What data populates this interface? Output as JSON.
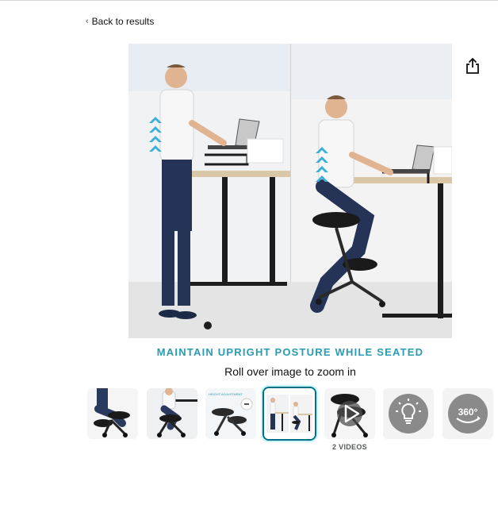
{
  "nav": {
    "back_chevron": "‹",
    "back_label": "Back to results"
  },
  "share": {
    "icon": "share-icon"
  },
  "main_image": {
    "icon": "standing-and-kneeling-chair-photo"
  },
  "caption": "MAINTAIN UPRIGHT POSTURE WHILE SEATED",
  "zoom_hint": "Roll over image to zoom in",
  "thumbnails": [
    {
      "icon": "kneeling-chair-side-view",
      "selected": false
    },
    {
      "icon": "man-on-kneeling-chair",
      "selected": false
    },
    {
      "icon": "height-adjustment-chair",
      "selected": false
    },
    {
      "icon": "standing-vs-seated-desk",
      "selected": true
    },
    {
      "icon": "video-play-icon",
      "selected": false
    },
    {
      "icon": "lightbulb-icon",
      "selected": false
    },
    {
      "icon": "360-view-icon",
      "selected": false
    }
  ],
  "videos_label": "2 VIDEOS",
  "thumbnail_badges": {
    "spin_label": "360°",
    "adjust_label": "HEIGHT ADJUSTMENT"
  },
  "colors": {
    "caption": "#2a9bb3",
    "selected_border": "#007185",
    "icon_circle": "#8a8a8a"
  }
}
